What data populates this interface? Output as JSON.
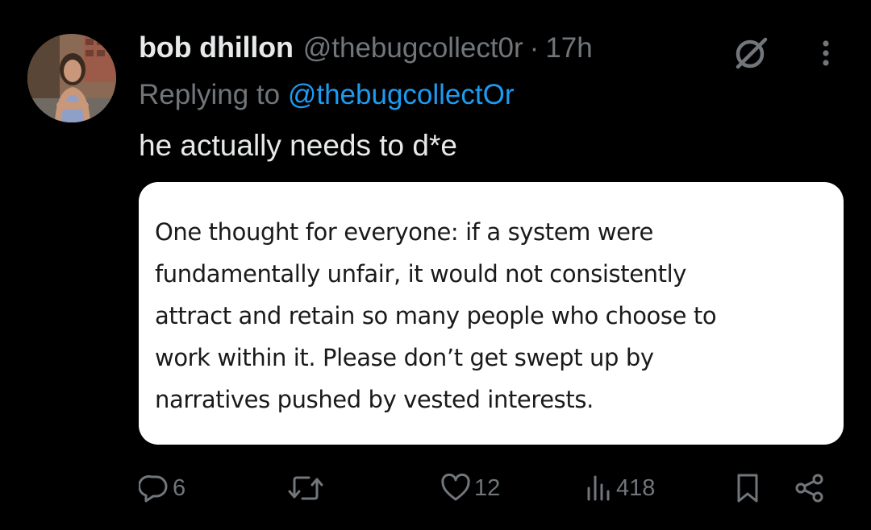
{
  "author": {
    "display_name": "bob dhillon",
    "handle": "@thebugcollect0r",
    "separator": "·",
    "timestamp": "17h",
    "avatar_icon": "profile-photo"
  },
  "reply": {
    "prefix": "Replying to ",
    "handle": "@thebugcollectOr"
  },
  "tweet_text": "he actually needs to d*e",
  "media": {
    "lines": [
      "One thought for everyone: if a system were",
      "fundamentally unfair, it would not consistently",
      "attract and retain so many people who choose to",
      "work within it. Please don’t get swept up by",
      "narratives pushed by vested interests."
    ]
  },
  "actions": {
    "replies": "6",
    "likes": "12",
    "views": "418"
  },
  "icons": {
    "grok": "grok-icon",
    "more": "more-dots-icon",
    "reply": "reply-bubble-icon",
    "retweet": "retweet-icon",
    "like": "heart-icon",
    "views": "views-chart-icon",
    "bookmark": "bookmark-icon",
    "share": "share-icon"
  },
  "colors": {
    "background": "#000000",
    "text_primary": "#e7e9ea",
    "text_secondary": "#71767b",
    "link": "#1d9bf0",
    "card": "#ffffff"
  }
}
